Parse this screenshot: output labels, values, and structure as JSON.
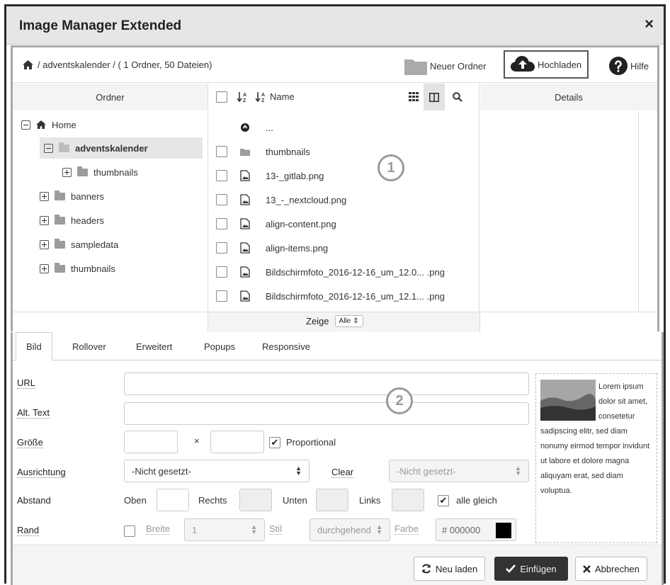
{
  "dialog": {
    "title": "Image Manager Extended",
    "close": "×"
  },
  "toolbar": {
    "breadcrumb": "/ adventskalender / ( 1 Ordner, 50 Dateien)",
    "new_folder": "Neuer Ordner",
    "upload": "Hochladen",
    "help": "Hilfe"
  },
  "columns": {
    "folders": "Ordner",
    "name": "Name",
    "details": "Details"
  },
  "tree": [
    {
      "label": "Home",
      "icon": "home-icon",
      "expander": "minus"
    },
    {
      "label": "adventskalender",
      "icon": "folder-open-icon",
      "expander": "minus",
      "selected": true
    },
    {
      "label": "thumbnails",
      "icon": "folder-icon",
      "expander": "plus"
    },
    {
      "label": "banners",
      "icon": "folder-icon",
      "expander": "plus"
    },
    {
      "label": "headers",
      "icon": "folder-icon",
      "expander": "plus"
    },
    {
      "label": "sampledata",
      "icon": "folder-icon",
      "expander": "plus"
    },
    {
      "label": "thumbnails",
      "icon": "folder-icon",
      "expander": "plus"
    }
  ],
  "files": [
    {
      "name": "...",
      "type": "up"
    },
    {
      "name": "thumbnails",
      "type": "folder"
    },
    {
      "name": "13-_gitlab.png",
      "type": "image"
    },
    {
      "name": "13_-_nextcloud.png",
      "type": "image"
    },
    {
      "name": "align-content.png",
      "type": "image"
    },
    {
      "name": "align-items.png",
      "type": "image"
    },
    {
      "name": "Bildschirmfoto_2016-12-16_um_12.0... .png",
      "type": "image"
    },
    {
      "name": "Bildschirmfoto_2016-12-16_um_12.1... .png",
      "type": "image"
    }
  ],
  "footer": {
    "show_label": "Zeige",
    "show_value": "Alle"
  },
  "markers": {
    "one": "1",
    "two": "2"
  },
  "tabs": [
    "Bild",
    "Rollover",
    "Erweitert",
    "Popups",
    "Responsive"
  ],
  "form": {
    "url": "URL",
    "alt": "Alt. Text",
    "size": "Größe",
    "size_x": "×",
    "proportional": "Proportional",
    "align": "Ausrichtung",
    "align_value": "-Nicht gesetzt-",
    "clear": "Clear",
    "clear_value": "-Nicht gesetzt-",
    "spacing": "Abstand",
    "top": "Oben",
    "right": "Rechts",
    "bottom": "Unten",
    "left": "Links",
    "all_equal": "alle gleich",
    "border": "Rand",
    "width": "Breite",
    "width_value": "1",
    "style": "Stil",
    "style_value": "durchgehend",
    "color": "Farbe",
    "color_value": "# 000000",
    "color_swatch": "#000000"
  },
  "preview_text": "Lorem ipsum dolor sit amet, consetetur sadipscing elitr, sed diam nonumy eirmod tempor invidunt ut labore et dolore magna aliquyam erat, sed diam voluptua.",
  "buttons": {
    "reload": "Neu laden",
    "insert": "Einfügen",
    "cancel": "Abbrechen"
  }
}
